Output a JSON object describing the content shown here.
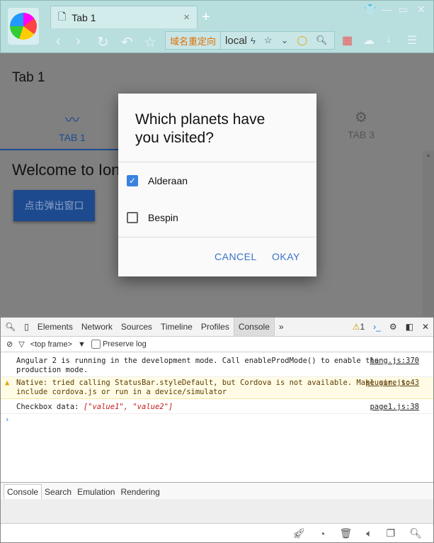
{
  "browser": {
    "tab_title": "Tab 1",
    "new_tab": "+",
    "close": "×",
    "redirect_label": "域名重定向",
    "url": "localhost",
    "window": {
      "skin": "👕",
      "min": "—",
      "max": "▭",
      "close": "✕"
    }
  },
  "app": {
    "title": "Tab 1",
    "tabs": [
      {
        "label": "TAB 1",
        "icon": "pulse-icon"
      },
      {
        "label": "TAB 3",
        "icon": "gear-icon"
      }
    ],
    "welcome": "Welcome to Ionic",
    "button": "点击弹出窗口"
  },
  "dialog": {
    "title": "Which planets have you visited?",
    "options": [
      {
        "label": "Alderaan",
        "checked": true
      },
      {
        "label": "Bespin",
        "checked": false
      }
    ],
    "cancel": "CANCEL",
    "okay": "OKAY",
    "accent": "#3b82e0"
  },
  "devtools": {
    "tabs": [
      "Elements",
      "Network",
      "Sources",
      "Timeline",
      "Profiles",
      "Console",
      "»"
    ],
    "warn_count": "1",
    "frame": "<top frame>",
    "preserve_log": "Preserve log",
    "messages": [
      {
        "text": "Angular 2 is running in the development mode. Call enableProdMode() to enable the production mode.",
        "source": "lang.js:370"
      },
      {
        "text": "Native: tried calling StatusBar.styleDefault, but Cordova is not available. Make sure to include cordova.js or run in a device/simulator",
        "source": "plugin.js:43"
      },
      {
        "prefix": "Checkbox data: ",
        "array": "[\"value1\", \"value2\"]",
        "source": "page1.js:38"
      }
    ],
    "prompt": "›",
    "drawer_tabs": [
      "Console",
      "Search",
      "Emulation",
      "Rendering"
    ]
  }
}
